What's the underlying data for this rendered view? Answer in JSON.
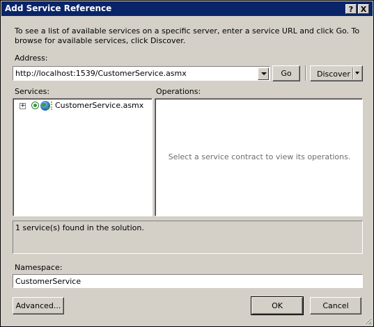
{
  "window": {
    "title": "Add Service Reference",
    "help_glyph": "?",
    "close_glyph": "X"
  },
  "description": "To see a list of available services on a specific server, enter a service URL and click Go. To browse for available services, click Discover.",
  "address": {
    "label": "Address:",
    "value": "http://localhost:1539/CustomerService.asmx"
  },
  "buttons": {
    "go": "Go",
    "discover": "Discover",
    "advanced": "Advanced...",
    "ok": "OK",
    "cancel": "Cancel"
  },
  "services": {
    "label": "Services:",
    "expander": "+",
    "items": [
      {
        "label": "CustomerService.asmx"
      }
    ]
  },
  "operations": {
    "label": "Operations:",
    "empty_message": "Select a service contract to view its operations."
  },
  "status": {
    "message": "1 service(s) found in the solution."
  },
  "namespace": {
    "label": "Namespace:",
    "value": "CustomerService"
  },
  "colors": {
    "titlebar": "#0a246a",
    "face": "#d4d0c8"
  },
  "icons": [
    "question-mark-icon",
    "close-icon",
    "chevron-down-icon",
    "tree-expander-icon",
    "service-icon",
    "size-grip-icon"
  ]
}
